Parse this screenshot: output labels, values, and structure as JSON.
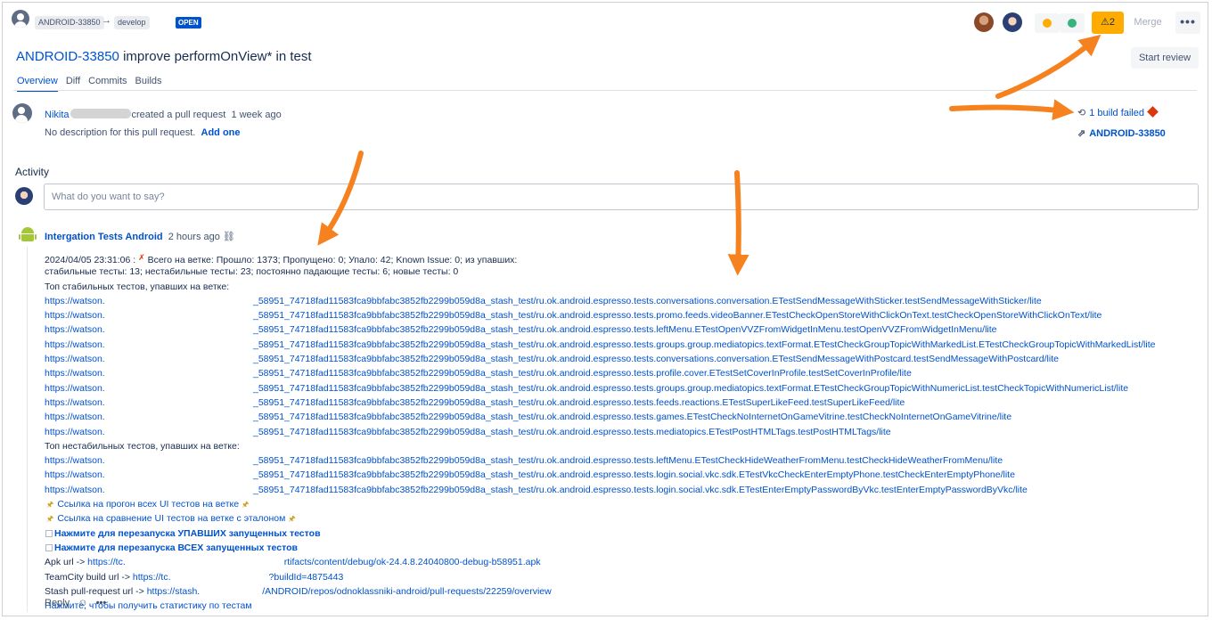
{
  "header": {
    "source_branch": "ANDROID-33850",
    "target_branch": "develop",
    "state_badge": "OPEN",
    "warning_count": "2",
    "merge_label": "Merge",
    "more_label": "•••",
    "start_review_label": "Start review"
  },
  "title": {
    "key": "ANDROID-33850",
    "text": "improve performOnView* in test"
  },
  "tabs": [
    "Overview",
    "Diff",
    "Commits",
    "Builds"
  ],
  "creator": {
    "name": "Nikita",
    "action": "created a pull request",
    "time": "1 week ago",
    "description": "No description for this pull request.",
    "add_description_link": "Add one"
  },
  "sidebar": {
    "build_status": "1 build failed",
    "issue_key": "ANDROID-33850"
  },
  "activity": {
    "heading": "Activity",
    "input_placeholder": "What do you want to say?"
  },
  "comment": {
    "author": "Intergation Tests Android",
    "time": "2 hours ago",
    "summary_line1_ts": "2024/04/05 23:31:06 :",
    "summary_line1_text": "Всего на ветке: Прошло: 1373; Пропущено: 0; Упало: 42; Known Issue: 0; из упавших:",
    "summary_line2": "стабильные тесты: 13; нестабильные тесты: 23; постоянно падающие тесты: 6; новые тесты: 0",
    "stable_heading": "Топ стабильных тестов, упавших на ветке:",
    "stable_links": [
      {
        "host": "https://watson.",
        "path": "_58951_74718fad11583fca9bbfabc3852fb2299b059d8a_stash_test/ru.ok.android.espresso.tests.conversations.conversation.ETestSendMessageWithSticker.testSendMessageWithSticker/lite"
      },
      {
        "host": "https://watson.",
        "path": "_58951_74718fad11583fca9bbfabc3852fb2299b059d8a_stash_test/ru.ok.android.espresso.tests.promo.feeds.videoBanner.ETestCheckOpenStoreWithClickOnText.testCheckOpenStoreWithClickOnText/lite"
      },
      {
        "host": "https://watson.",
        "path": "_58951_74718fad11583fca9bbfabc3852fb2299b059d8a_stash_test/ru.ok.android.espresso.tests.leftMenu.ETestOpenVVZFromWidgetInMenu.testOpenVVZFromWidgetInMenu/lite"
      },
      {
        "host": "https://watson.",
        "path": "_58951_74718fad11583fca9bbfabc3852fb2299b059d8a_stash_test/ru.ok.android.espresso.tests.groups.group.mediatopics.textFormat.ETestCheckGroupTopicWithMarkedList.ETestCheckGroupTopicWithMarkedList/lite"
      },
      {
        "host": "https://watson.",
        "path": "_58951_74718fad11583fca9bbfabc3852fb2299b059d8a_stash_test/ru.ok.android.espresso.tests.conversations.conversation.ETestSendMessageWithPostcard.testSendMessageWithPostcard/lite"
      },
      {
        "host": "https://watson.",
        "path": "_58951_74718fad11583fca9bbfabc3852fb2299b059d8a_stash_test/ru.ok.android.espresso.tests.profile.cover.ETestSetCoverInProfile.testSetCoverInProfile/lite"
      },
      {
        "host": "https://watson.",
        "path": "_58951_74718fad11583fca9bbfabc3852fb2299b059d8a_stash_test/ru.ok.android.espresso.tests.groups.group.mediatopics.textFormat.ETestCheckGroupTopicWithNumericList.testCheckTopicWithNumericList/lite"
      },
      {
        "host": "https://watson.",
        "path": "_58951_74718fad11583fca9bbfabc3852fb2299b059d8a_stash_test/ru.ok.android.espresso.tests.feeds.reactions.ETestSuperLikeFeed.testSuperLikeFeed/lite"
      },
      {
        "host": "https://watson.",
        "path": "_58951_74718fad11583fca9bbfabc3852fb2299b059d8a_stash_test/ru.ok.android.espresso.tests.games.ETestCheckNoInternetOnGameVitrine.testCheckNoInternetOnGameVitrine/lite"
      },
      {
        "host": "https://watson.",
        "path": "_58951_74718fad11583fca9bbfabc3852fb2299b059d8a_stash_test/ru.ok.android.espresso.tests.mediatopics.ETestPostHTMLTags.testPostHTMLTags/lite"
      }
    ],
    "unstable_heading": "Топ нестабильных тестов, упавших на ветке:",
    "unstable_links": [
      {
        "host": "https://watson.",
        "path": "_58951_74718fad11583fca9bbfabc3852fb2299b059d8a_stash_test/ru.ok.android.espresso.tests.leftMenu.ETestCheckHideWeatherFromMenu.testCheckHideWeatherFromMenu/lite"
      },
      {
        "host": "https://watson.",
        "path": "_58951_74718fad11583fca9bbfabc3852fb2299b059d8a_stash_test/ru.ok.android.espresso.tests.login.social.vkc.sdk.ETestVkcCheckEnterEmptyPhone.testCheckEnterEmptyPhone/lite"
      },
      {
        "host": "https://watson.",
        "path": "_58951_74718fad11583fca9bbfabc3852fb2299b059d8a_stash_test/ru.ok.android.espresso.tests.login.social.vkc.sdk.ETestEnterEmptyPasswordByVkc.testEnterEmptyPasswordByVkc/lite"
      }
    ],
    "all_ui_link": "Ссылка на прогон всех UI тестов на ветке",
    "compare_link": "Ссылка на сравнение UI тестов на ветке с эталоном",
    "rerun_failed": "Нажмите для перезапуска УПАВШИХ запущенных тестов",
    "rerun_all": "Нажмите для перезапуска ВСЕХ запущенных тестов",
    "apk_label": "Apk url ->",
    "apk_host": "https://tc.",
    "apk_tail": "rtifacts/content/debug/ok-24.4.8.24040800-debug-b58951.apk",
    "tc_label": "TeamCity build url ->",
    "tc_host": "https://tc.",
    "tc_tail": "?buildId=4875443",
    "stash_label": "Stash pull-request url ->",
    "stash_host": "https://stash.",
    "stash_tail": "/ANDROID/repos/odnoklassniki-android/pull-requests/22259/overview",
    "stats_link": "Нажмите, чтобы получить статистику по тестам",
    "reply_label": "Reply",
    "more_label": "•••"
  },
  "colors": {
    "link": "#0052cc",
    "warning": "#ffab00",
    "annotation_arrow": "#f5821f",
    "error": "#de350b"
  },
  "icons": {
    "branch_arrow": "arrow-right-icon",
    "build": "build-sync-icon",
    "jira": "jira-icon",
    "link": "permalink-icon",
    "emoji": "emoji-icon"
  }
}
